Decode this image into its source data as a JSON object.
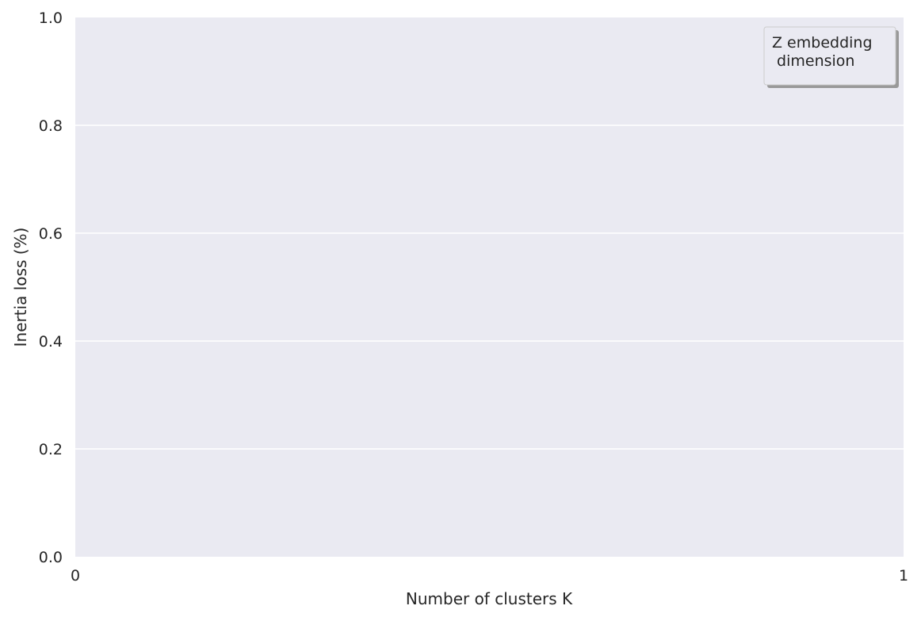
{
  "chart_data": {
    "type": "line",
    "title": "",
    "xlabel": "Number of clusters K",
    "ylabel": "Inertia loss (%)",
    "xlim": [
      0,
      1
    ],
    "ylim": [
      0,
      1
    ],
    "x_ticks": [
      "0",
      "1"
    ],
    "y_ticks": [
      "0.0",
      "0.2",
      "0.4",
      "0.6",
      "0.8",
      "1.0"
    ],
    "grid": true,
    "series": [],
    "legend": {
      "title_lines": [
        "Z embedding",
        " dimension"
      ],
      "placement": "top-right",
      "shadow": true
    },
    "colors": {
      "plot_background": "#eaeaf2",
      "grid": "#ffffff",
      "text": "#262626",
      "legend_background": "#eaeaf2",
      "legend_border": "#cccccc",
      "legend_shadow": "#999999"
    }
  }
}
